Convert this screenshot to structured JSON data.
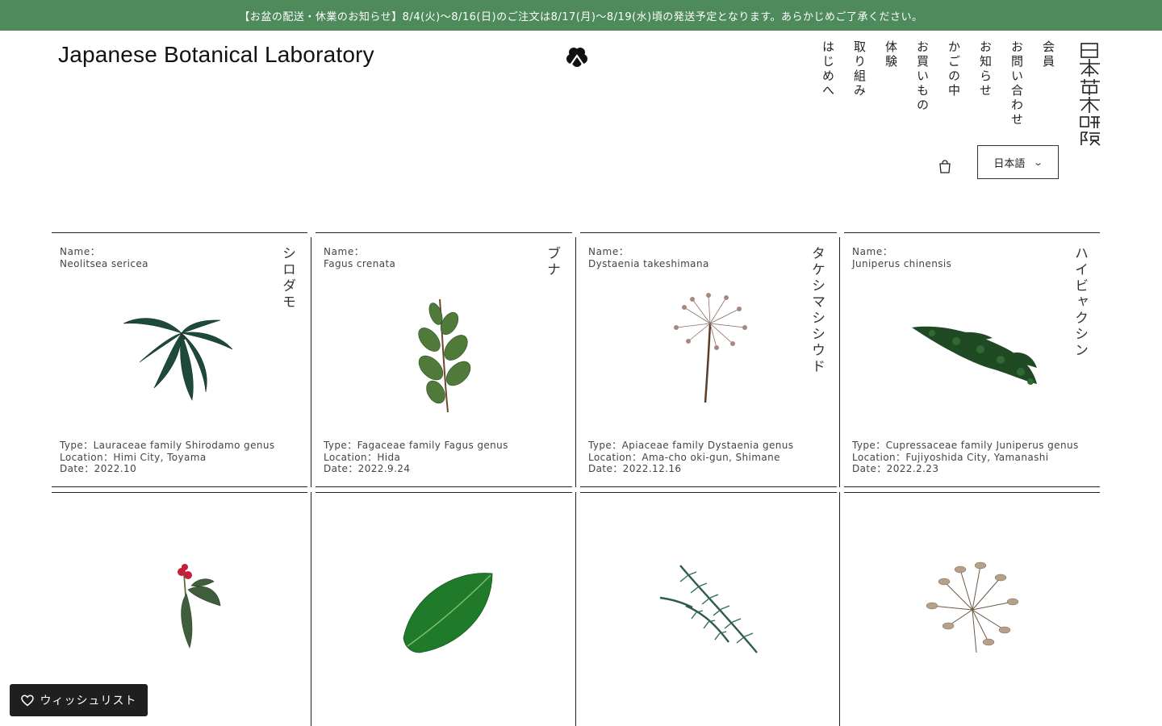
{
  "announcement": "【お盆の配送・休業のお知らせ】8/4(火)〜8/16(日)のご注文は8/17(月)〜8/19(水)頃の発送予定となります。あらかじめご了承ください。",
  "brand": "Japanese Botanical Laboratory",
  "logo_text": "日本草木研究所",
  "nav": [
    "会員",
    "お問い合わせ",
    "お知らせ",
    "かごの中",
    "お買いもの",
    "体験",
    "取り組み",
    "はじめへ"
  ],
  "language": {
    "selected": "日本語"
  },
  "wishlist_label": "ウィッシュリスト",
  "colors": {
    "announcement_bg": "#4e8a5c",
    "wishlist_bg": "#1f1f1f"
  },
  "cards": [
    {
      "name_label": "Name：",
      "latin": "Neolitsea sericea",
      "kana": "シロダモ",
      "type": "Type：Lauraceae family Shirodamo genus",
      "location": "Location：Himi City, Toyama",
      "date": "Date：2022.10"
    },
    {
      "name_label": "Name：",
      "latin": "Fagus crenata",
      "kana": "ブナ",
      "type": "Type：Fagaceae family Fagus genus",
      "location": "Location：Hida",
      "date": "Date：2022.9.24"
    },
    {
      "name_label": "Name：",
      "latin": "Dystaenia takeshimana",
      "kana": "タケシマシシウド",
      "type": "Type：Apiaceae family Dystaenia genus",
      "location": "Location：Ama-cho oki-gun, Shimane",
      "date": "Date：2022.12.16"
    },
    {
      "name_label": "Name：",
      "latin": "Juniperus chinensis",
      "kana": "ハイビャクシン",
      "type": "Type：Cupressaceae family Juniperus genus",
      "location": "Location：Fujiyoshida City, Yamanashi",
      "date": "Date：2022.2.23"
    }
  ]
}
